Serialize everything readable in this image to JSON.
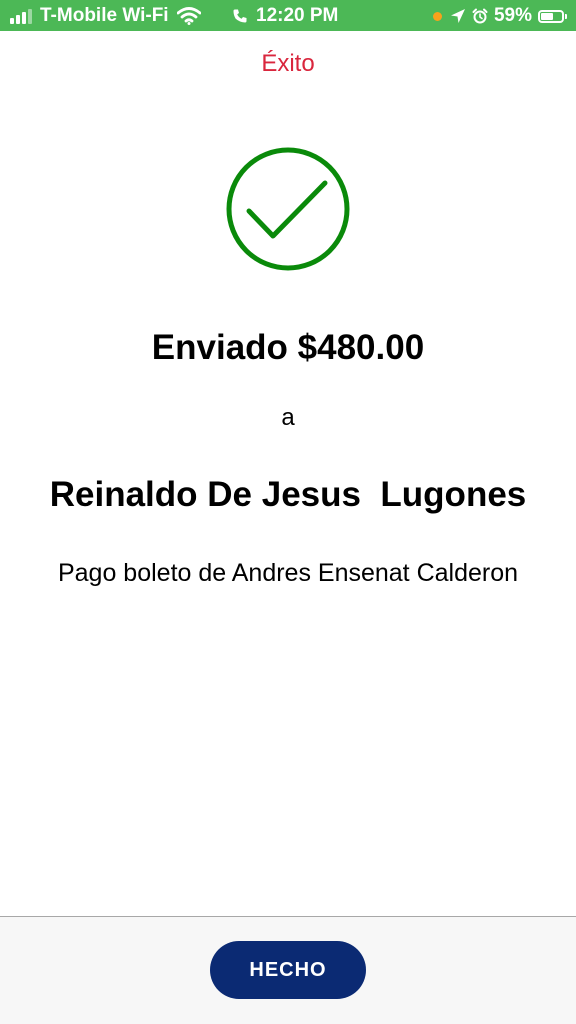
{
  "status_bar": {
    "carrier": "T-Mobile Wi-Fi",
    "time": "12:20 PM",
    "battery_percent": "59%",
    "battery_level": 0.59,
    "signal_bars_filled": 3,
    "signal_bars_total": 4,
    "background_color": "#4cb856",
    "icons": [
      "signal-icon",
      "wifi-icon",
      "phone-icon",
      "orange-dot",
      "location-icon",
      "alarm-icon",
      "battery-icon"
    ]
  },
  "header": {
    "title": "Éxito",
    "title_color": "#d9263d"
  },
  "success": {
    "icon": "checkmark-circle-icon",
    "icon_color": "#0a8a0a"
  },
  "transaction": {
    "amount_line": "Enviado $480.00",
    "connector": "a",
    "recipient": "Reinaldo De Jesus  Lugones",
    "memo": "Pago boleto de Andres Ensenat Calderon"
  },
  "footer": {
    "done_label": "HECHO",
    "button_color": "#0b2a73"
  }
}
